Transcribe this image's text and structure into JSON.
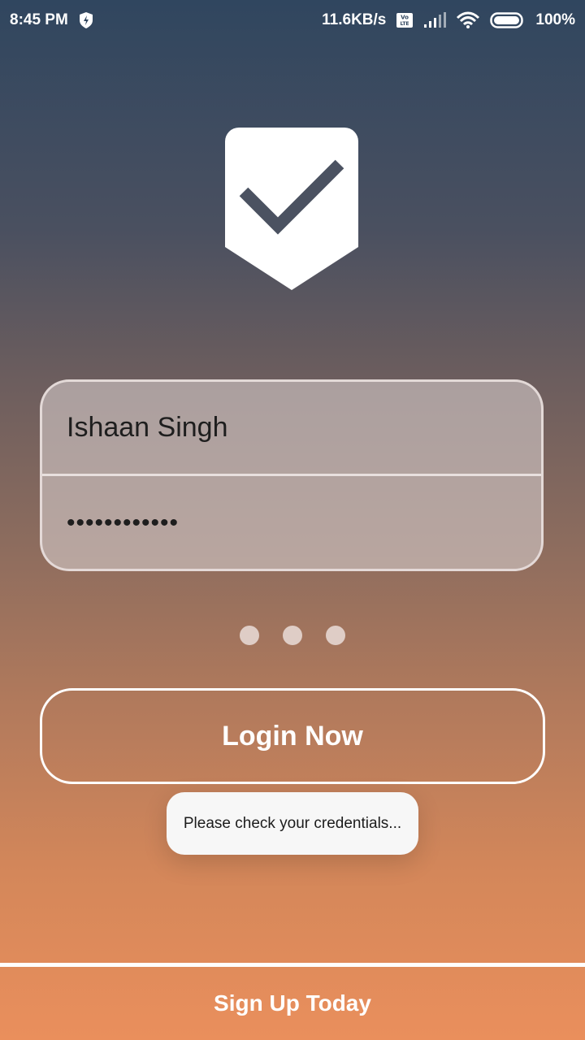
{
  "status_bar": {
    "time": "8:45 PM",
    "network_speed": "11.6KB/s",
    "battery": "100%",
    "icons": [
      "bolt-shield-icon",
      "volte-icon",
      "signal-icon",
      "wifi-icon",
      "battery-icon"
    ]
  },
  "logo": {
    "icon": "shield-check-icon"
  },
  "form": {
    "username_value": "Ishaan Singh",
    "password_value": "••••••••••••"
  },
  "pager": {
    "pages": 3
  },
  "buttons": {
    "login_label": "Login Now",
    "signup_label": "Sign Up Today"
  },
  "toast": {
    "message": "Please check your credentials..."
  },
  "colors": {
    "gradient_top": "#30465f",
    "gradient_bottom": "#ea8f5c",
    "logo_fill": "#ffffff",
    "check_stroke": "#4b5261"
  }
}
